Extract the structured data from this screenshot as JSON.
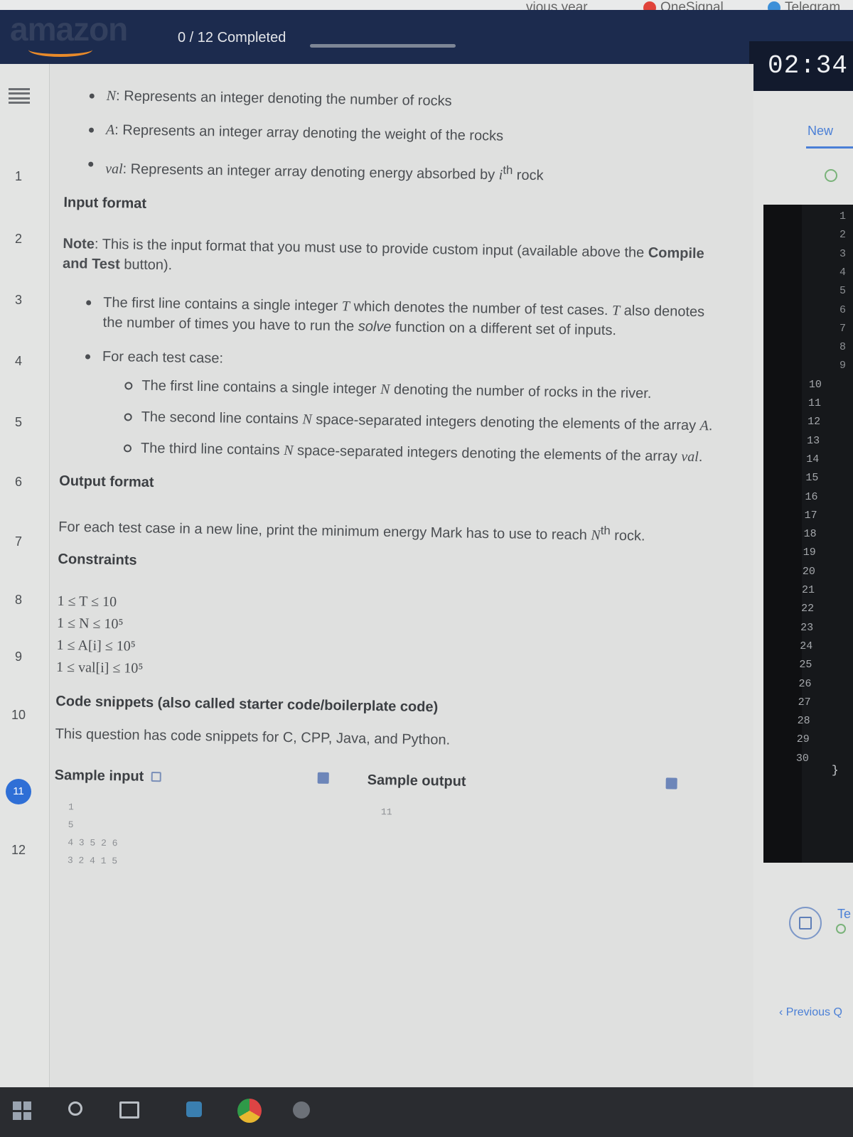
{
  "browser": {
    "partial_tab": "vious year",
    "bookmarks": [
      {
        "label": "OneSignal",
        "color": "#e0433a"
      },
      {
        "label": "Telegram",
        "color": "#3c8fd8"
      }
    ]
  },
  "header": {
    "logo_text": "amazon",
    "progress_label": "0 / 12 Completed",
    "progress_fraction": 0.0,
    "timer": "02:34:"
  },
  "nav": {
    "question_numbers": [
      "1",
      "2",
      "3",
      "4",
      "5",
      "6",
      "7",
      "8",
      "9",
      "10",
      "11",
      "12"
    ],
    "active_question": "11"
  },
  "problem": {
    "params": [
      {
        "var": "N",
        "text": ": Represents an integer denoting the number of rocks"
      },
      {
        "var": "A",
        "text": ": Represents an integer array denoting the weight of the rocks"
      },
      {
        "var": "val",
        "text": ": Represents an integer array denoting energy absorbed by ",
        "sup_var": "i",
        "sup": "th",
        "tail": " rock"
      }
    ],
    "input_heading": "Input format",
    "note_label": "Note",
    "note_text_1": ": This is the input format that you must use to provide custom input (available above the ",
    "note_bold": "Compile and Test",
    "note_text_2": " button).",
    "input_bullets": {
      "first_line_a": "The first line contains a single integer ",
      "first_line_var": "T",
      "first_line_b": " which denotes the number of test cases. ",
      "first_line_var2": "T",
      "first_line_c": " also denotes the number of times you have to run the ",
      "first_line_fn": "solve",
      "first_line_d": " function on a different set of inputs.",
      "each_case": "For each test case:",
      "sub": [
        {
          "a": "The first line contains a single integer ",
          "v": "N",
          "b": " denoting the number of rocks in the river."
        },
        {
          "a": "The second line contains ",
          "v": "N",
          "b": " space-separated integers denoting the elements of the array ",
          "v2": "A",
          "c": "."
        },
        {
          "a": "The third line contains ",
          "v": "N",
          "b": " space-separated integers denoting the elements of the array ",
          "v2": "val",
          "c": "."
        }
      ]
    },
    "output_heading": "Output format",
    "output_text_a": "For each test case in a new line, print the minimum energy Mark has to use to reach ",
    "output_var": "N",
    "output_sup": "th",
    "output_text_b": " rock.",
    "constraints_heading": "Constraints",
    "constraints": [
      "1 ≤ T ≤ 10",
      "1 ≤ N ≤ 10⁵",
      "1 ≤ A[i] ≤ 10⁵",
      "1 ≤ val[i] ≤ 10⁵"
    ],
    "snippets_heading": "Code snippets (also called starter code/boilerplate code)",
    "snippets_text": "This question has code snippets for C, CPP, Java, and Python.",
    "sample_input_label": "Sample input",
    "sample_output_label": "Sample output",
    "sample_input_lines": [
      "1",
      "5",
      "4 3 5 2 6",
      "3 2 4 1 5"
    ],
    "sample_output_lines": [
      "11"
    ]
  },
  "right_panel": {
    "new_tab": "New",
    "line_numbers": [
      "1",
      "2",
      "3",
      "4",
      "5",
      "6",
      "7",
      "8",
      "9",
      "10",
      "11",
      "12",
      "13",
      "14",
      "15",
      "16",
      "17",
      "18",
      "19",
      "20",
      "21",
      "22",
      "23",
      "24",
      "25",
      "26",
      "27",
      "28",
      "29",
      "30"
    ],
    "closing_brace": "}",
    "test_label": "Te",
    "previous_link": "‹ Previous Q"
  }
}
